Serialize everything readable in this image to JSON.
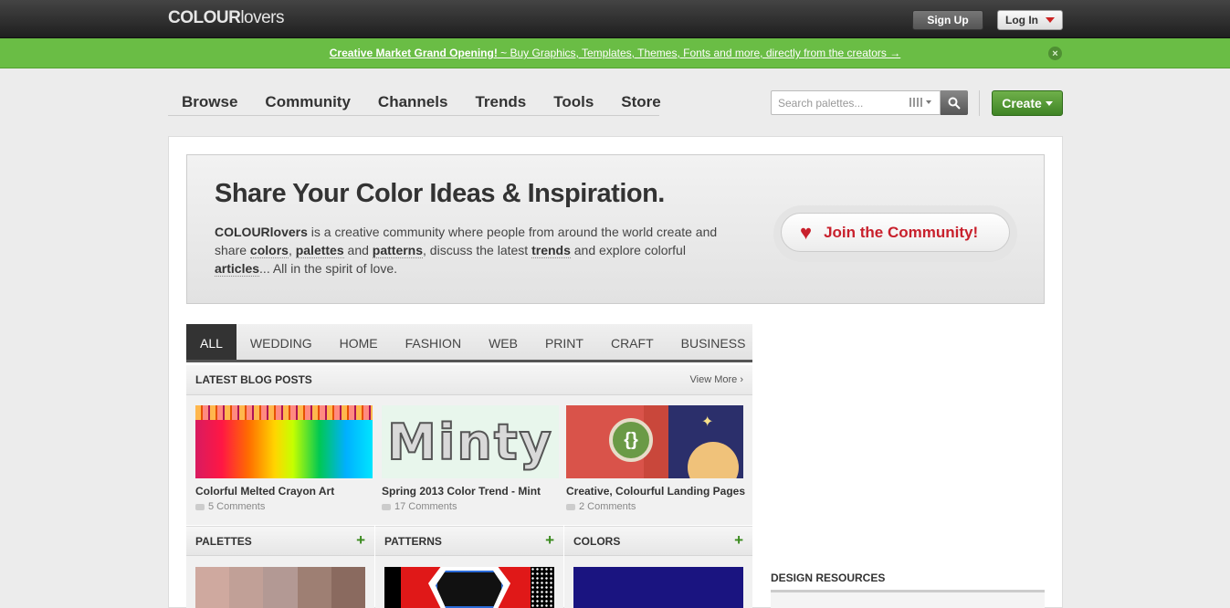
{
  "topbar": {
    "logo_bold": "COLOUR",
    "logo_rest": "lovers",
    "signup_label": "Sign Up",
    "login_label": "Log In"
  },
  "promo": {
    "link_bold": "Creative Market Grand Opening!",
    "link_rest": " ~ Buy Graphics, Templates, Themes, Fonts and more, directly from the creators →"
  },
  "nav": {
    "items": [
      "Browse",
      "Community",
      "Channels",
      "Trends",
      "Tools",
      "Store"
    ]
  },
  "search": {
    "placeholder": "Search palettes..."
  },
  "create_label": "Create",
  "hero": {
    "title": "Share Your Color Ideas & Inspiration.",
    "brand": "COLOURlovers",
    "t1": " is a creative community where people from around the world create and share ",
    "colors": "colors",
    "t2": ", ",
    "palettes": "palettes",
    "t3": " and ",
    "patterns": "patterns",
    "t4": ", discuss the latest ",
    "trends": "trends",
    "t5": " and explore colorful ",
    "articles": "articles",
    "t6": "... All in the spirit of love.",
    "join_label": "Join the Community!"
  },
  "tabs": [
    "ALL",
    "WEDDING",
    "HOME",
    "FASHION",
    "WEB",
    "PRINT",
    "CRAFT",
    "BUSINESS"
  ],
  "blog": {
    "heading": "LATEST BLOG POSTS",
    "view_more": "View More ›",
    "posts": [
      {
        "title": "Colorful Melted Crayon Art",
        "comments": "5 Comments"
      },
      {
        "title": "Spring 2013 Color Trend - Mint",
        "comments": "17 Comments",
        "thumb_text": "Minty"
      },
      {
        "title": "Creative, Colourful Landing Pages",
        "comments": "2 Comments",
        "thumb_text": "{}"
      }
    ]
  },
  "columns": {
    "palettes": "PALETTES",
    "patterns": "PATTERNS",
    "colors": "COLORS",
    "plus": "+"
  },
  "sidebar": {
    "design_resources": "DESIGN RESOURCES"
  },
  "palette_swatches": [
    "#cfa99f",
    "#c1a097",
    "#b39994",
    "#9e7f73",
    "#8a6a5f"
  ],
  "color_swatch": "#1a1480",
  "accent": {
    "green": "#6abd45",
    "create_green": "#4f9a30",
    "join_red": "#c8202c"
  }
}
